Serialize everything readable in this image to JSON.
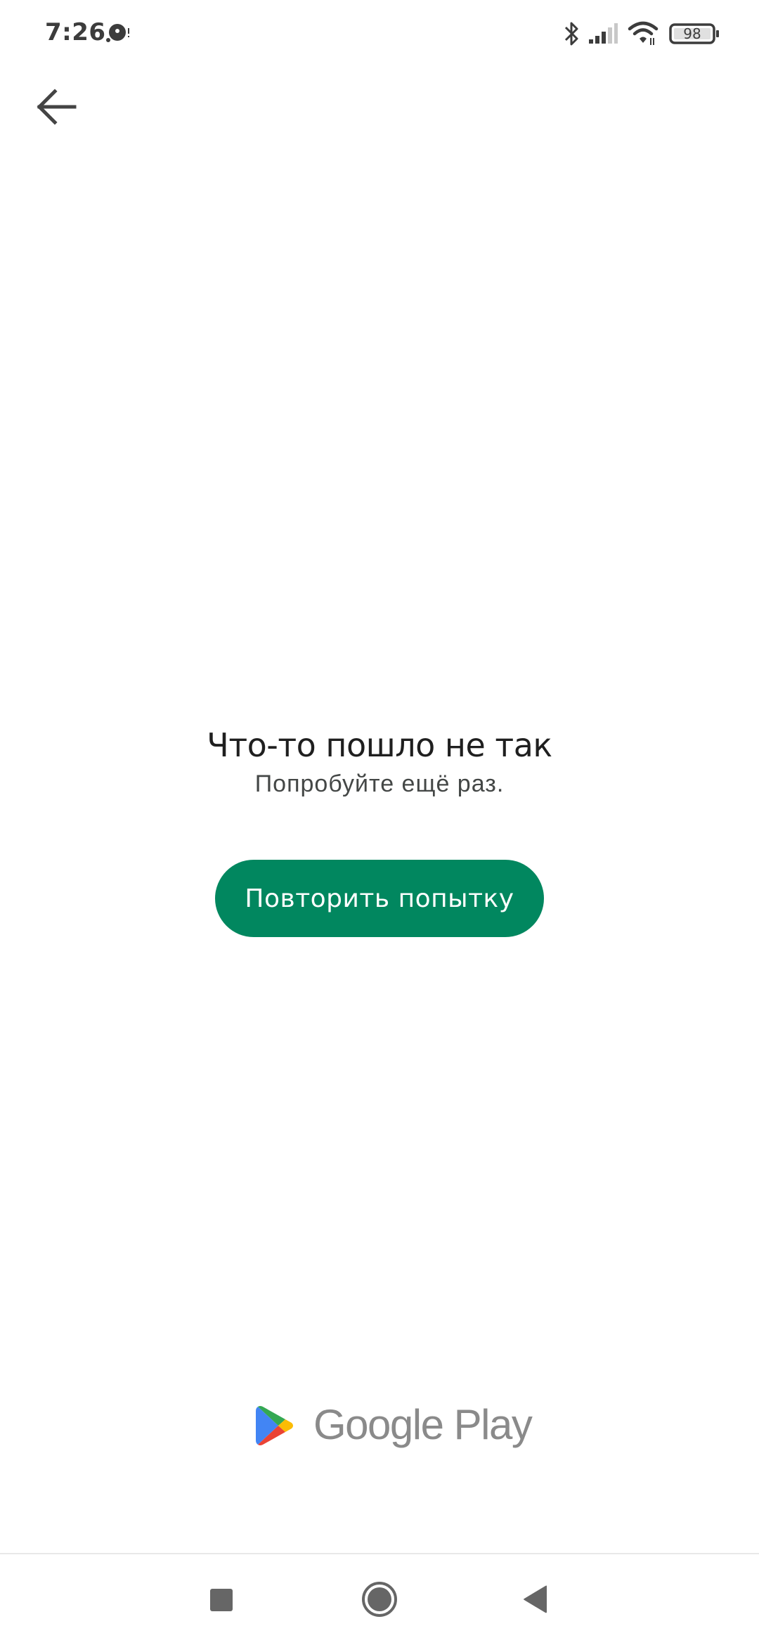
{
  "status_bar": {
    "time": "7:26",
    "notification_icon": "data-saver-icon",
    "icons": [
      "bluetooth-icon",
      "signal-icon",
      "wifi-icon",
      "battery-icon"
    ],
    "battery_level": "98"
  },
  "header": {
    "back_icon": "arrow-back-icon"
  },
  "error": {
    "title": "Что-то пошло не так",
    "subtitle": "Попробуйте ещё раз.",
    "retry_label": "Повторить попытку"
  },
  "branding": {
    "logo_text": "Google Play",
    "logo_icon": "google-play-icon"
  },
  "nav_bar": {
    "buttons": [
      "recents-button",
      "home-button",
      "back-button"
    ]
  },
  "colors": {
    "accent": "#01875f",
    "title_text": "#1f1f1f",
    "subtitle_text": "#444746",
    "logo_text": "#8a8a8a",
    "icon_gray": "#5f5f5f"
  }
}
